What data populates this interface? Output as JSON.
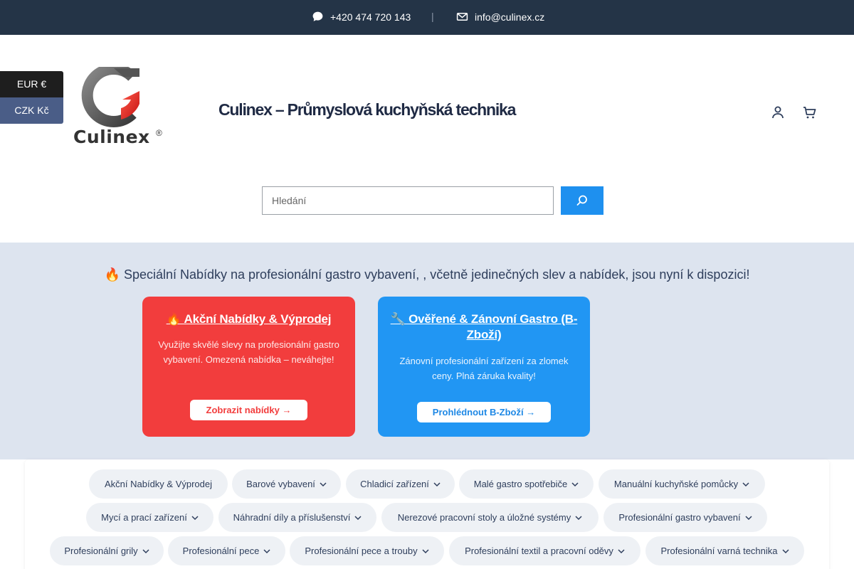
{
  "topbar": {
    "phone": "+420 474 720 143",
    "separator": "|",
    "email": "info@culinex.cz",
    "phone_icon": "chat-bubble-icon",
    "email_icon": "envelope-icon"
  },
  "currency": {
    "eur": "EUR €",
    "czk": "CZK Kč"
  },
  "logo": {
    "wordmark": "Culinex",
    "registered": "®"
  },
  "header": {
    "site_title": "Culinex – Průmyslová kuchyňská technika",
    "account_icon": "user-icon",
    "cart_icon": "cart-icon"
  },
  "search": {
    "placeholder": "Hledání",
    "button_icon": "search-icon"
  },
  "promo": {
    "headline": "🔥 Speciální Nabídky na profesionální gastro vybavení, , včetně jedinečných slev a nabídek, jsou nyní k dispozici!",
    "cards": [
      {
        "title": "🔥 Akční Nabídky & Výprodej",
        "desc": "Využijte skvělé slevy na profesionální gastro vybavení. Omezená nabídka – neváhejte!",
        "button": "Zobrazit nabídky →"
      },
      {
        "title": "🔧 Ověřené & Zánovní Gastro (B-Zboží)",
        "desc": "Zánovní profesionální zařízení za zlomek ceny. Plná záruka kvality!",
        "button": "Prohlédnout B-Zboží →"
      }
    ],
    "colors": {
      "red": "#f23d3d",
      "blue": "#2196f3"
    }
  },
  "categories": [
    {
      "label": "Akční Nabídky & Výprodej",
      "dropdown": false
    },
    {
      "label": "Barové vybavení",
      "dropdown": true
    },
    {
      "label": "Chladicí zařízení",
      "dropdown": true
    },
    {
      "label": "Malé gastro spotřebiče",
      "dropdown": true
    },
    {
      "label": "Manuální kuchyňské pomůcky",
      "dropdown": true
    },
    {
      "label": "Mycí a prací zařízení",
      "dropdown": true
    },
    {
      "label": "Náhradní díly a příslušenství",
      "dropdown": true
    },
    {
      "label": "Nerezové pracovní stoly a úložné systémy",
      "dropdown": true
    },
    {
      "label": "Profesionální gastro vybavení",
      "dropdown": true
    },
    {
      "label": "Profesionální grily",
      "dropdown": true
    },
    {
      "label": "Profesionální pece",
      "dropdown": true
    },
    {
      "label": "Profesionální pece a trouby",
      "dropdown": true
    },
    {
      "label": "Profesionální textil a pracovní oděvy",
      "dropdown": true
    },
    {
      "label": "Profesionální varná technika",
      "dropdown": true
    }
  ]
}
